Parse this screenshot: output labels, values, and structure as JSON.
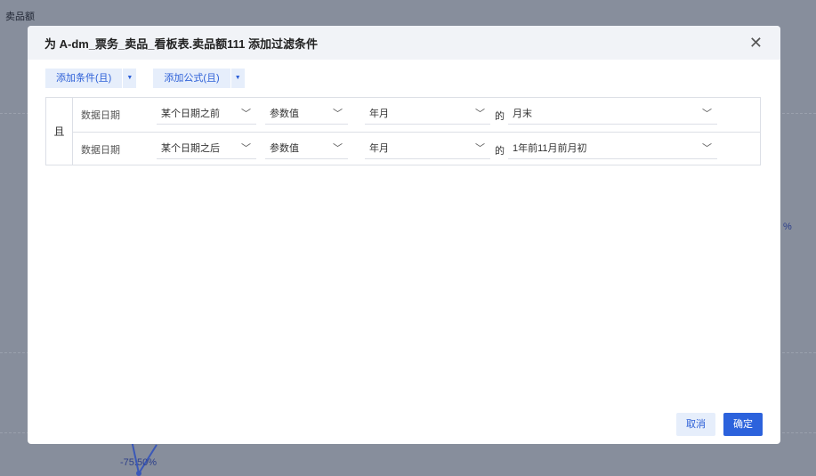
{
  "background": {
    "chart_title": "卖品额",
    "labels": [
      "-75.50%",
      "%"
    ]
  },
  "dialog": {
    "title": "为 A-dm_票务_卖品_看板表.卖品额111 添加过滤条件",
    "close_icon": "close-icon",
    "toolbar": {
      "add_condition": "添加条件(且)",
      "add_formula": "添加公式(且)"
    },
    "logic_label": "且",
    "conditions": [
      {
        "field": "数据日期",
        "operator": "某个日期之前",
        "value_type": "参数值",
        "granularity": "年月",
        "of": "的",
        "value": "月末"
      },
      {
        "field": "数据日期",
        "operator": "某个日期之后",
        "value_type": "参数值",
        "granularity": "年月",
        "of": "的",
        "value": "1年前11月前月初"
      }
    ],
    "cancel": "取消",
    "confirm": "确定"
  },
  "colors": {
    "accent": "#2c62dc",
    "overlay": "#878e9c"
  }
}
